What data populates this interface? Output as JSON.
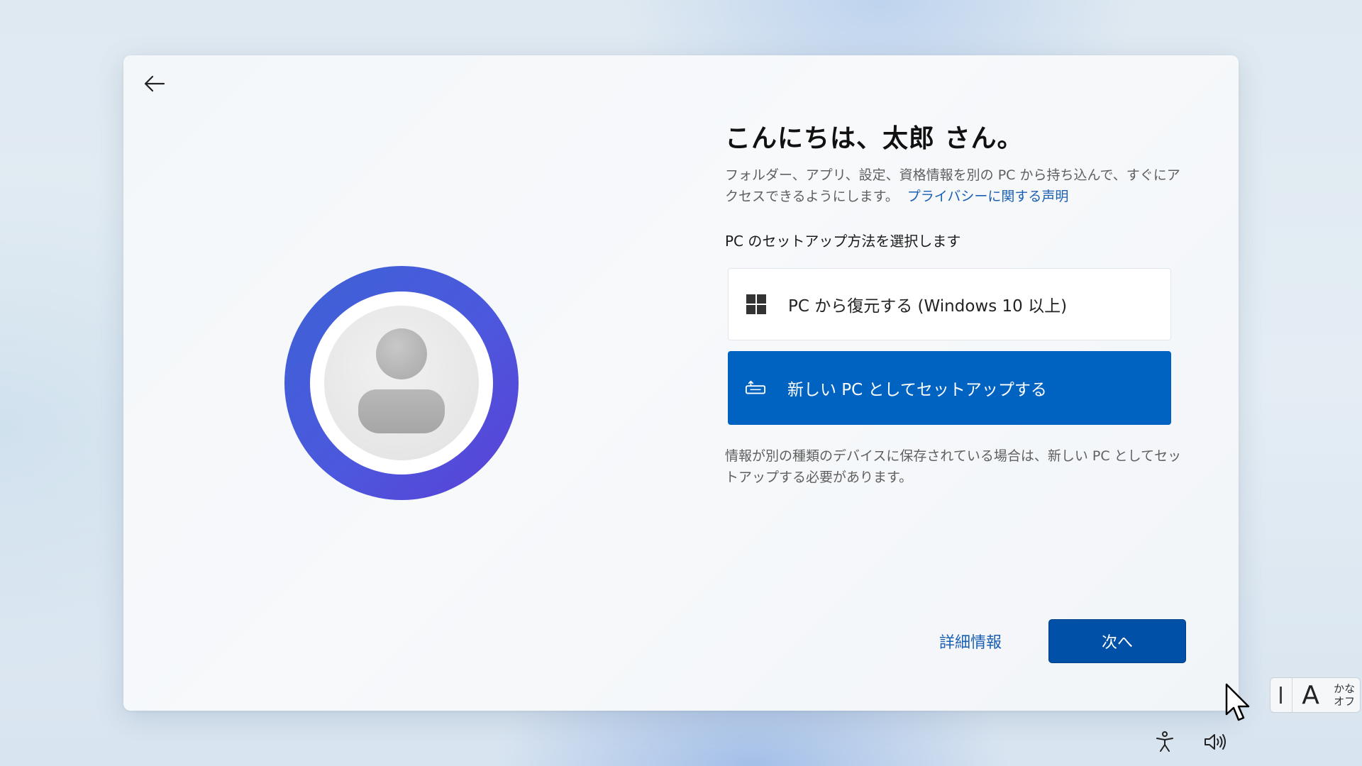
{
  "card": {
    "title": "こんにちは、太郎 さん。",
    "description": "フォルダー、アプリ、設定、資格情報を別の PC から持ち込んで、すぐにアクセスできるようにします。",
    "privacy_link": "プライバシーに関する声明",
    "subheading": "PC のセットアップ方法を選択します",
    "options": [
      {
        "label": "PC から復元する (Windows 10 以上)",
        "icon": "windows-logo-icon",
        "selected": false
      },
      {
        "label": "新しい PC としてセットアップする",
        "icon": "new-pc-icon",
        "selected": true
      }
    ],
    "note": "情報が別の種類のデバイスに保存されている場合は、新しい PC としてセットアップする必要があります。",
    "more_info": "詳細情報",
    "next_label": "次へ"
  },
  "ime": {
    "mode": "A",
    "kana_line1": "かな",
    "kana_line2": "オフ"
  },
  "icons": {
    "back": "back-arrow-icon",
    "accessibility": "accessibility-icon",
    "volume": "volume-icon",
    "avatar": "user-avatar-icon"
  },
  "colors": {
    "accent": "#0063c1",
    "next_button": "#0050a8",
    "link": "#1a5fb4",
    "avatar_ring": "#4c58dd"
  }
}
